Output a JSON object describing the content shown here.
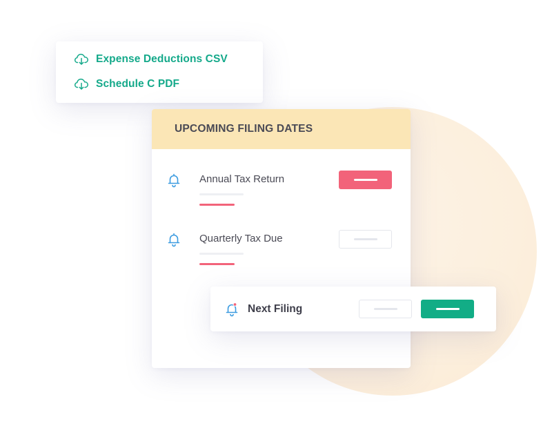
{
  "downloads": {
    "items": [
      {
        "label": "Expense Deductions CSV",
        "icon": "cloud-download-icon"
      },
      {
        "label": "Schedule C PDF",
        "icon": "cloud-download-icon"
      }
    ]
  },
  "filing": {
    "header": "UPCOMING FILING DATES",
    "rows": [
      {
        "label": "Annual Tax Return",
        "icon": "bell-icon"
      },
      {
        "label": "Quarterly Tax Due",
        "icon": "bell-icon"
      }
    ]
  },
  "next_filing": {
    "label": "Next Filing",
    "icon": "bell-notification-icon"
  },
  "colors": {
    "accent_green": "#12ad86",
    "alert_red": "#f2637a",
    "header_yellow": "#fbe6b6",
    "background_circle": "#fcefdd"
  }
}
